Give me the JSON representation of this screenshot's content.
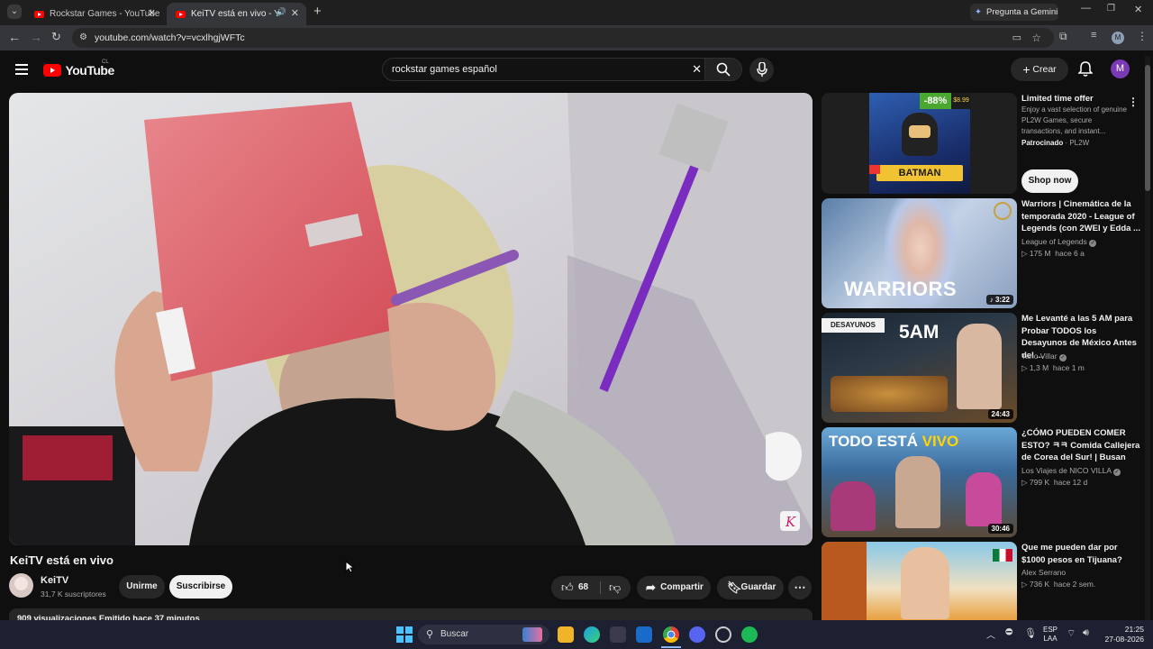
{
  "browser": {
    "tabs": [
      {
        "title": "Rockstar Games - YouTube"
      },
      {
        "title": "KeiTV está en vivo - YouTube"
      }
    ],
    "gemini_label": "Pregunta a Gemini",
    "url": "youtube.com/watch?v=vcxlhgjWFTc",
    "profile_initial": "M"
  },
  "header": {
    "logo": "YouTube",
    "country": "CL",
    "search_value": "rockstar games español",
    "create_label": "Crear",
    "avatar_initial": "M"
  },
  "video": {
    "title": "KeiTV está en vivo",
    "channel": "KeiTV",
    "subscribers": "31,7 K suscriptores",
    "join_label": "Unirme",
    "subscribe_label": "Suscribirse",
    "likes": "68",
    "share_label": "Compartir",
    "save_label": "Guardar",
    "description_snippet": "909 visualizaciones  Emitido hace 37 minutos"
  },
  "sidebar": {
    "ad": {
      "title": "Limited time offer",
      "desc": "Enjoy a vast selection of genuine PL2W Games, secure transactions, and instant...",
      "sponsor": "Patrocinado",
      "advertiser": "PL2W",
      "discount": "-88%",
      "price": "$8.99",
      "thumb_text": "BATMAN",
      "cta": "Shop now"
    },
    "videos": [
      {
        "title": "Warriors | Cinemática de la temporada 2020 - League of Legends (con 2WEI y Edda ...",
        "channel": "League of Legends",
        "views": "175 M",
        "age": "hace 6 a",
        "duration": "3:22",
        "thumb_text": "WARRIORS"
      },
      {
        "title": "Me Levanté a las 5 AM para Probar TODOS los Desayunos de México Antes del ...",
        "channel": "Tano Villar",
        "views": "1,3 M",
        "age": "hace 1 m",
        "duration": "24:43",
        "thumb_text": "5AM",
        "thumb_text2": "DESAYUNOS"
      },
      {
        "title": "¿CÓMO PUEDEN COMER ESTO? ㅋㅋ Comida Callejera de Corea del Sur! | Busan",
        "channel": "Los Viajes de NICO VILLA",
        "views": "799 K",
        "age": "hace 12 d",
        "duration": "30:46",
        "thumb_text": "TODO ESTÁ",
        "thumb_text_accent": "VIVO"
      },
      {
        "title": "Que me pueden dar por $1000 pesos en Tijuana?",
        "channel": "Alex Serrano",
        "views": "736 K",
        "age": "hace 2 sem.",
        "duration": ""
      }
    ]
  },
  "taskbar": {
    "search_placeholder": "Buscar",
    "lang": "ESP",
    "lang2": "LAA",
    "time": "21:25",
    "date": "27-08-2026"
  }
}
